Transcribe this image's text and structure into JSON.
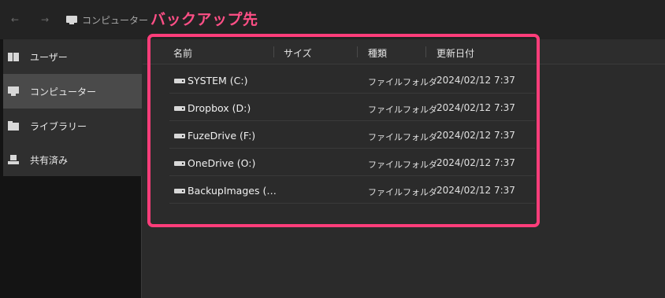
{
  "nav": {
    "back_glyph": "←",
    "forward_glyph": "→",
    "breadcrumb_icon": "computer-icon",
    "breadcrumb_label": "コンピューター"
  },
  "annotation": {
    "title": "バックアップ先",
    "color": "#ff3d7a"
  },
  "sidebar": {
    "items": [
      {
        "label": "ユーザー",
        "icon": "users-icon",
        "active": false
      },
      {
        "label": "コンピューター",
        "icon": "computer-icon",
        "active": true
      },
      {
        "label": "ライブラリー",
        "icon": "folder-icon",
        "active": false
      },
      {
        "label": "共有済み",
        "icon": "shared-icon",
        "active": false
      }
    ]
  },
  "table": {
    "columns": {
      "name": "名前",
      "size": "サイズ",
      "type": "種類",
      "date": "更新日付"
    },
    "rows": [
      {
        "name": "SYSTEM (C:)",
        "size": "",
        "type": "ファイルフォルダ",
        "date": "2024/02/12 7:37",
        "icon": "drive-icon"
      },
      {
        "name": "Dropbox (D:)",
        "size": "",
        "type": "ファイルフォルダ",
        "date": "2024/02/12 7:37",
        "icon": "drive-icon"
      },
      {
        "name": "FuzeDrive (F:)",
        "size": "",
        "type": "ファイルフォルダ",
        "date": "2024/02/12 7:37",
        "icon": "drive-icon"
      },
      {
        "name": "OneDrive (O:)",
        "size": "",
        "type": "ファイルフォルダ",
        "date": "2024/02/12 7:37",
        "icon": "drive-icon"
      },
      {
        "name": "BackupImages (…",
        "size": "",
        "type": "ファイルフォルダ",
        "date": "2024/02/12 7:37",
        "icon": "drive-icon"
      }
    ]
  },
  "colors": {
    "background": "#2b2b2b",
    "sidebar": "#141414",
    "sidebar_active": "#4a4a4a",
    "accent": "#ff3d7a"
  }
}
